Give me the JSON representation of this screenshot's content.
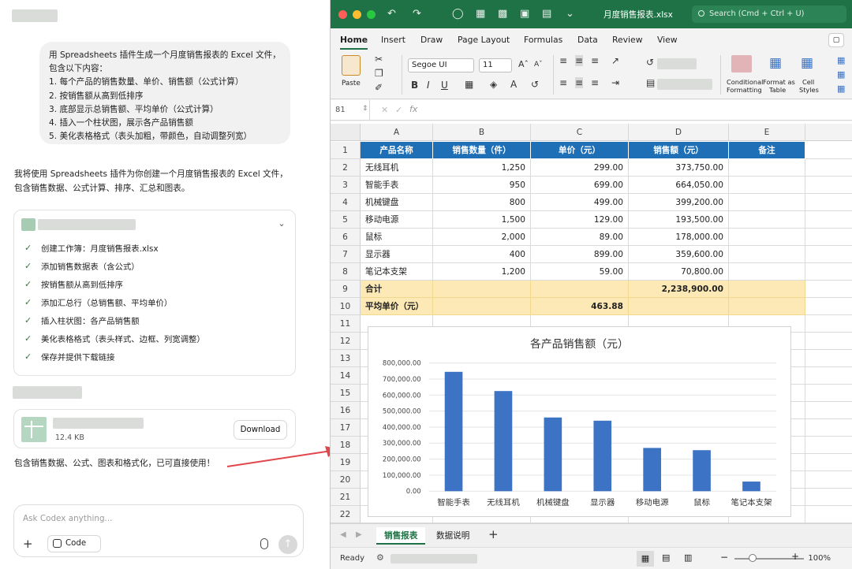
{
  "chat": {
    "user_message": [
      "用 Spreadsheets 插件生成一个月度销售报表的 Excel 文件，",
      "包含以下内容：",
      "1. 每个产品的销售数量、单价、销售额（公式计算）",
      "2. 按销售额从高到低排序",
      "3. 底部显示总销售额、平均单价（公式计算）",
      "4. 插入一个柱状图，展示各产品销售额",
      "5. 美化表格格式（表头加粗，带颜色，自动调整列宽）"
    ],
    "assistant_intro": [
      "我将使用 Spreadsheets 插件为你创建一个月度销售报表的 Excel 文件，",
      "包含销售数据、公式计算、排序、汇总和图表。"
    ],
    "tasks": [
      "创建工作簿：月度销售报表.xlsx",
      "添加销售数据表（含公式）",
      "按销售额从高到低排序",
      "添加汇总行（总销售额、平均单价）",
      "插入柱状图：各产品销售额",
      "美化表格格式（表头样式、边框、列宽调整）",
      "保存并提供下载链接"
    ],
    "file_size": "12.4 KB",
    "download_label": "Download",
    "final_text": "包含销售数据、公式、图表和格式化，已可直接使用！",
    "composer_placeholder": "Ask Codex anything...",
    "code_chip": "Code"
  },
  "excel": {
    "doc_title": "月度销售报表.xlsx",
    "search_placeholder": "Search (Cmd + Ctrl + U)",
    "ribbon_tabs": [
      "Home",
      "Insert",
      "Draw",
      "Page Layout",
      "Formulas",
      "Data",
      "Review",
      "View"
    ],
    "font_name": "Segoe UI",
    "font_size": "11",
    "paste_label": "Paste",
    "conditional_formatting": [
      "Conditional",
      "Formatting"
    ],
    "format_as_table": [
      "Format as",
      "Table"
    ],
    "cell_styles": [
      "Cell",
      "Styles"
    ],
    "name_box": "81",
    "columns": [
      "A",
      "B",
      "C",
      "D",
      "E"
    ],
    "rows": [
      "1",
      "2",
      "3",
      "4",
      "5",
      "6",
      "7",
      "8",
      "9",
      "10",
      "11",
      "12",
      "13",
      "14",
      "15",
      "16",
      "17",
      "18",
      "19",
      "20",
      "21",
      "22"
    ],
    "table_header": [
      "产品名称",
      "销售数量（件）",
      "单价（元）",
      "销售额（元）",
      "备注"
    ],
    "table_rows": [
      [
        "无线耳机",
        "1,250",
        "299.00",
        "373,750.00",
        ""
      ],
      [
        "智能手表",
        "950",
        "699.00",
        "664,050.00",
        ""
      ],
      [
        "机械键盘",
        "800",
        "499.00",
        "399,200.00",
        ""
      ],
      [
        "移动电源",
        "1,500",
        "129.00",
        "193,500.00",
        ""
      ],
      [
        "鼠标",
        "2,000",
        "89.00",
        "178,000.00",
        ""
      ],
      [
        "显示器",
        "400",
        "899.00",
        "359,600.00",
        ""
      ],
      [
        "笔记本支架",
        "1,200",
        "59.00",
        "70,800.00",
        ""
      ]
    ],
    "total_label": "合计",
    "total_value": "2,238,900.00",
    "avg_label": "平均单价（元）",
    "avg_value": "463.88",
    "sheet_tabs": [
      "销售报表",
      "数据说明"
    ],
    "status": "Ready",
    "zoom": "100%",
    "accent": "#1e7245",
    "header_fill": "#1f6fb7",
    "total_fill": "#fde9b6"
  },
  "chart_data": {
    "type": "bar",
    "title": "各产品销售额（元）",
    "categories": [
      "智能手表",
      "无线耳机",
      "机械键盘",
      "显示器",
      "移动电源",
      "鼠标",
      "笔记本支架"
    ],
    "values": [
      745000,
      625000,
      460000,
      440000,
      270000,
      256000,
      60000
    ],
    "ylim": [
      0,
      800000
    ],
    "yticks": [
      "0.00",
      "100,000.00",
      "200,000.00",
      "300,000.00",
      "400,000.00",
      "500,000.00",
      "600,000.00",
      "700,000.00",
      "800,000.00"
    ],
    "bar_color": "#3c73c4",
    "grid": true
  }
}
